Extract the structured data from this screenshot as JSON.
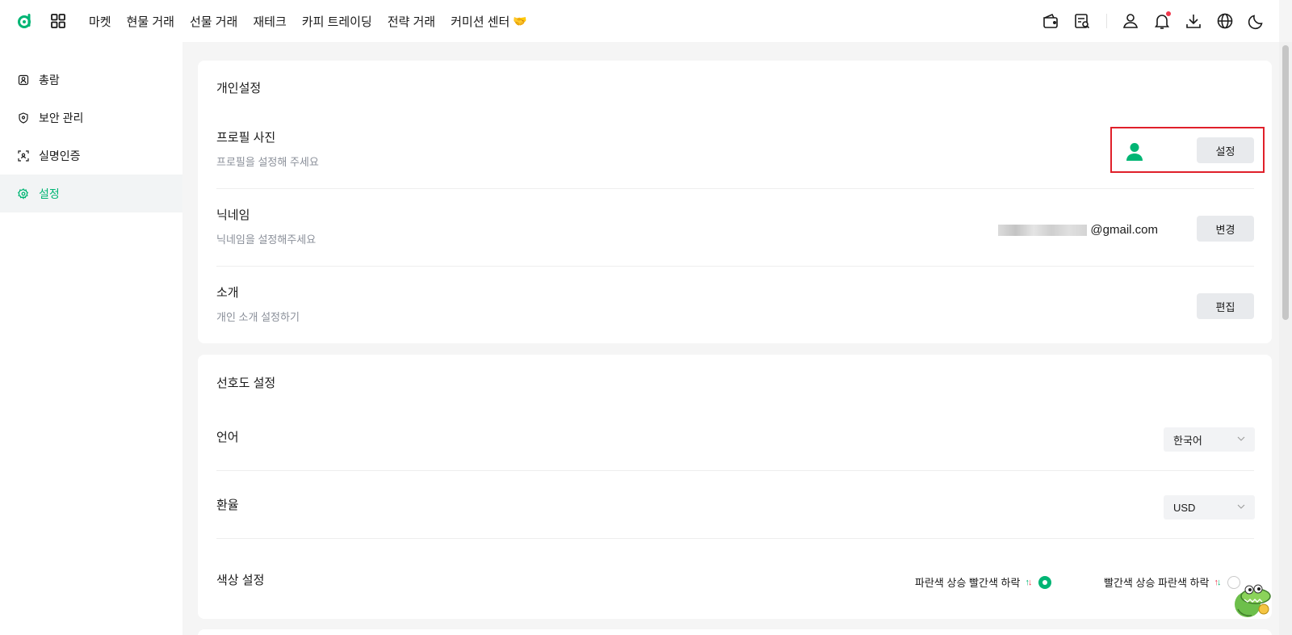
{
  "nav": {
    "items": [
      "마켓",
      "현물 거래",
      "선물 거래",
      "재테크",
      "카피 트레이딩",
      "전략 거래",
      "커미션 센터"
    ],
    "commission_icon": "handshake-icon"
  },
  "sidebar": {
    "items": [
      {
        "label": "총람",
        "icon": "overview-icon"
      },
      {
        "label": "보안 관리",
        "icon": "shield-icon"
      },
      {
        "label": "실명인증",
        "icon": "id-scan-icon"
      },
      {
        "label": "설정",
        "icon": "gear-icon",
        "active": true
      }
    ]
  },
  "personal": {
    "title": "개인설정",
    "profile_title": "프로필 사진",
    "profile_sub": "프로필을 설정해 주세요",
    "profile_button": "설정",
    "nickname_title": "닉네임",
    "nickname_sub": "닉네임을 설정해주세요",
    "nickname_value": "@gmail.com",
    "nickname_button": "변경",
    "intro_title": "소개",
    "intro_sub": "개인 소개 설정하기",
    "intro_button": "편집"
  },
  "preferences": {
    "title": "선호도 설정",
    "language_title": "언어",
    "language_value": "한국어",
    "currency_title": "환율",
    "currency_value": "USD",
    "color_title": "색상 설정",
    "color_option1": "파란색 상승 빨간색 하락",
    "color_option2": "빨간색 상승 파란색 하락",
    "selected_option": 1
  },
  "colors": {
    "accent": "#00b574",
    "danger": "#f0384d",
    "highlight_border": "#e0202a"
  }
}
